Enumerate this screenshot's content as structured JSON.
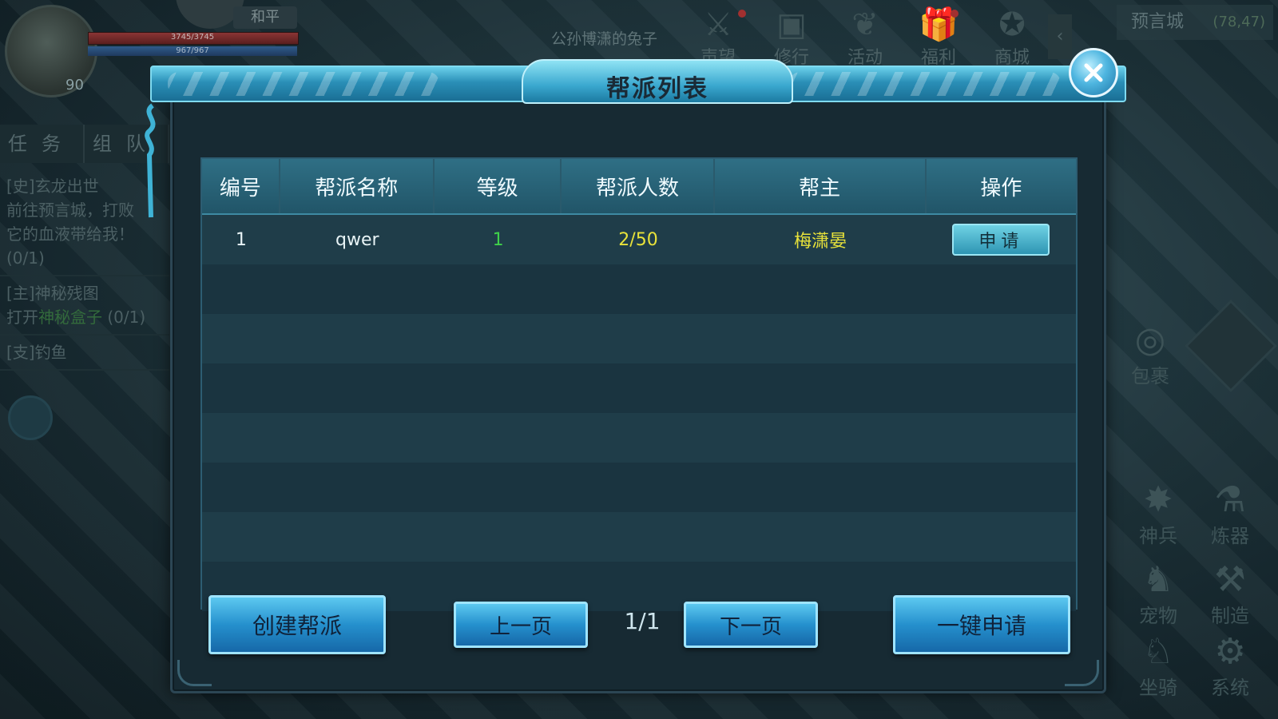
{
  "hud": {
    "peace_mode": "和平",
    "hp_text": "3745/3745",
    "mp_text": "967/967",
    "level": "90",
    "player_name": "公孙博潇的兔子",
    "top_icons": [
      {
        "label": "声望",
        "icon": "sword-icon"
      },
      {
        "label": "修行",
        "icon": "scroll-icon"
      },
      {
        "label": "活动",
        "icon": "wing-icon"
      },
      {
        "label": "福利",
        "icon": "gift-icon"
      },
      {
        "label": "商城",
        "icon": "shop-icon"
      }
    ],
    "location": "预言城",
    "coords": "(78,47)",
    "task_tabs": [
      "任务",
      "组队"
    ],
    "tasks": [
      {
        "title": "[史]玄龙出世",
        "desc": "前往预言城，打败",
        "desc2": "它的血液带给我！",
        "progress": "(0/1)"
      },
      {
        "title": "[主]神秘残图",
        "desc": "打开",
        "highlight": "神秘盒子",
        "progress": "(0/1)"
      },
      {
        "title": "[支]钓鱼",
        "desc": ""
      }
    ],
    "side_icons": [
      "包裹",
      "神兵",
      "炼器",
      "宠物",
      "制造",
      "坐骑",
      "系统"
    ]
  },
  "dialog": {
    "title": "帮派列表",
    "columns": [
      "编号",
      "帮派名称",
      "等级",
      "帮派人数",
      "帮主",
      "操作"
    ],
    "rows": [
      {
        "id": "1",
        "name": "qwer",
        "level": "1",
        "members": "2/50",
        "leader": "梅潇晏",
        "action": "申请"
      }
    ],
    "create_button": "创建帮派",
    "prev_button": "上一页",
    "page_indicator": "1/1",
    "next_button": "下一页",
    "one_click_apply": "一键申请"
  }
}
